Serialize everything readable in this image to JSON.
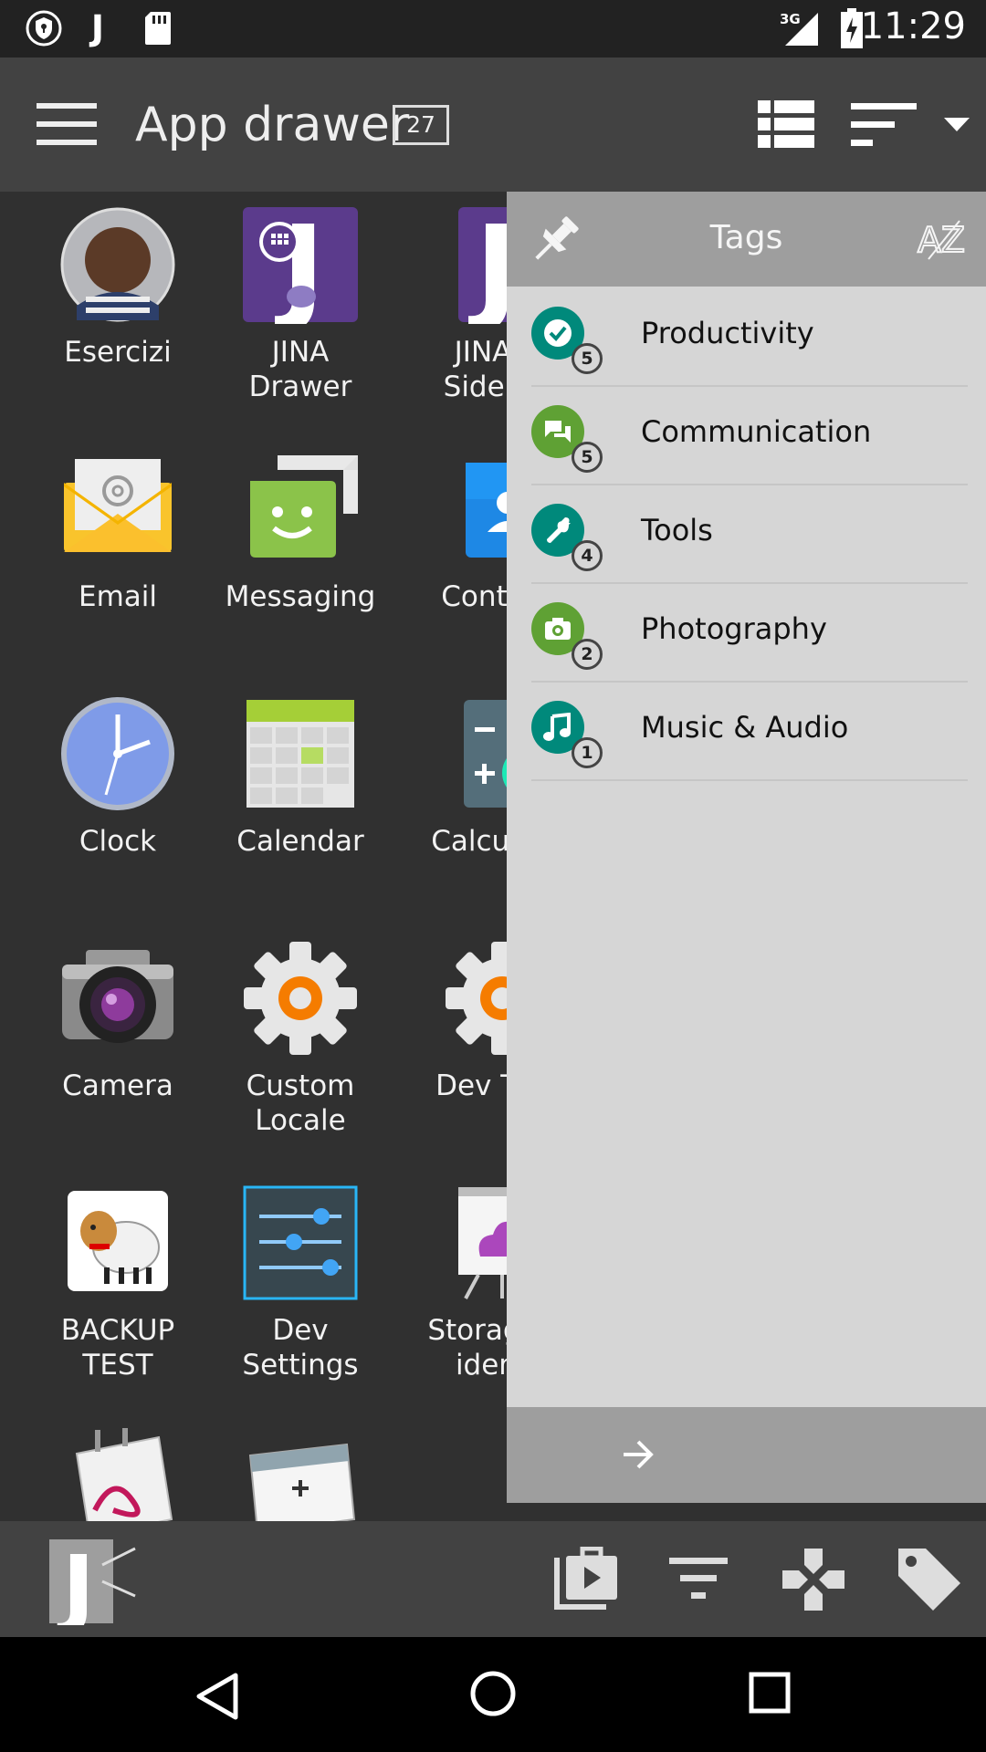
{
  "status_bar": {
    "time": "11:29",
    "network": "3G"
  },
  "toolbar": {
    "title": "App drawer",
    "count": "27"
  },
  "apps": [
    {
      "label": "Esercizi"
    },
    {
      "label": "JINA\nDrawer"
    },
    {
      "label": "JINA\nSideb"
    },
    {
      "label": "Email"
    },
    {
      "label": "Messaging"
    },
    {
      "label": "Conta"
    },
    {
      "label": "Clock"
    },
    {
      "label": "Calendar"
    },
    {
      "label": "Calcula"
    },
    {
      "label": "Camera"
    },
    {
      "label": "Custom\nLocale"
    },
    {
      "label": "Dev To"
    },
    {
      "label": "BACKUP\nTEST"
    },
    {
      "label": "Dev\nSettings"
    },
    {
      "label": "Storage\nider"
    }
  ],
  "tags_panel": {
    "title": "Tags",
    "sort_label": "AZ",
    "items": [
      {
        "label": "Productivity",
        "count": "5",
        "color": "#00897b",
        "icon": "check-icon"
      },
      {
        "label": "Communication",
        "count": "5",
        "color": "#5fa134",
        "icon": "chat-icon"
      },
      {
        "label": "Tools",
        "count": "4",
        "color": "#00897b",
        "icon": "wrench-icon"
      },
      {
        "label": "Photography",
        "count": "2",
        "color": "#5fa134",
        "icon": "camera-icon"
      },
      {
        "label": "Music & Audio",
        "count": "1",
        "color": "#00897b",
        "icon": "music-note-icon"
      }
    ]
  },
  "colors": {
    "toolbar": "#424242",
    "background": "#303030",
    "panel": "#d6d6d6",
    "panel_header": "#9e9e9e"
  }
}
